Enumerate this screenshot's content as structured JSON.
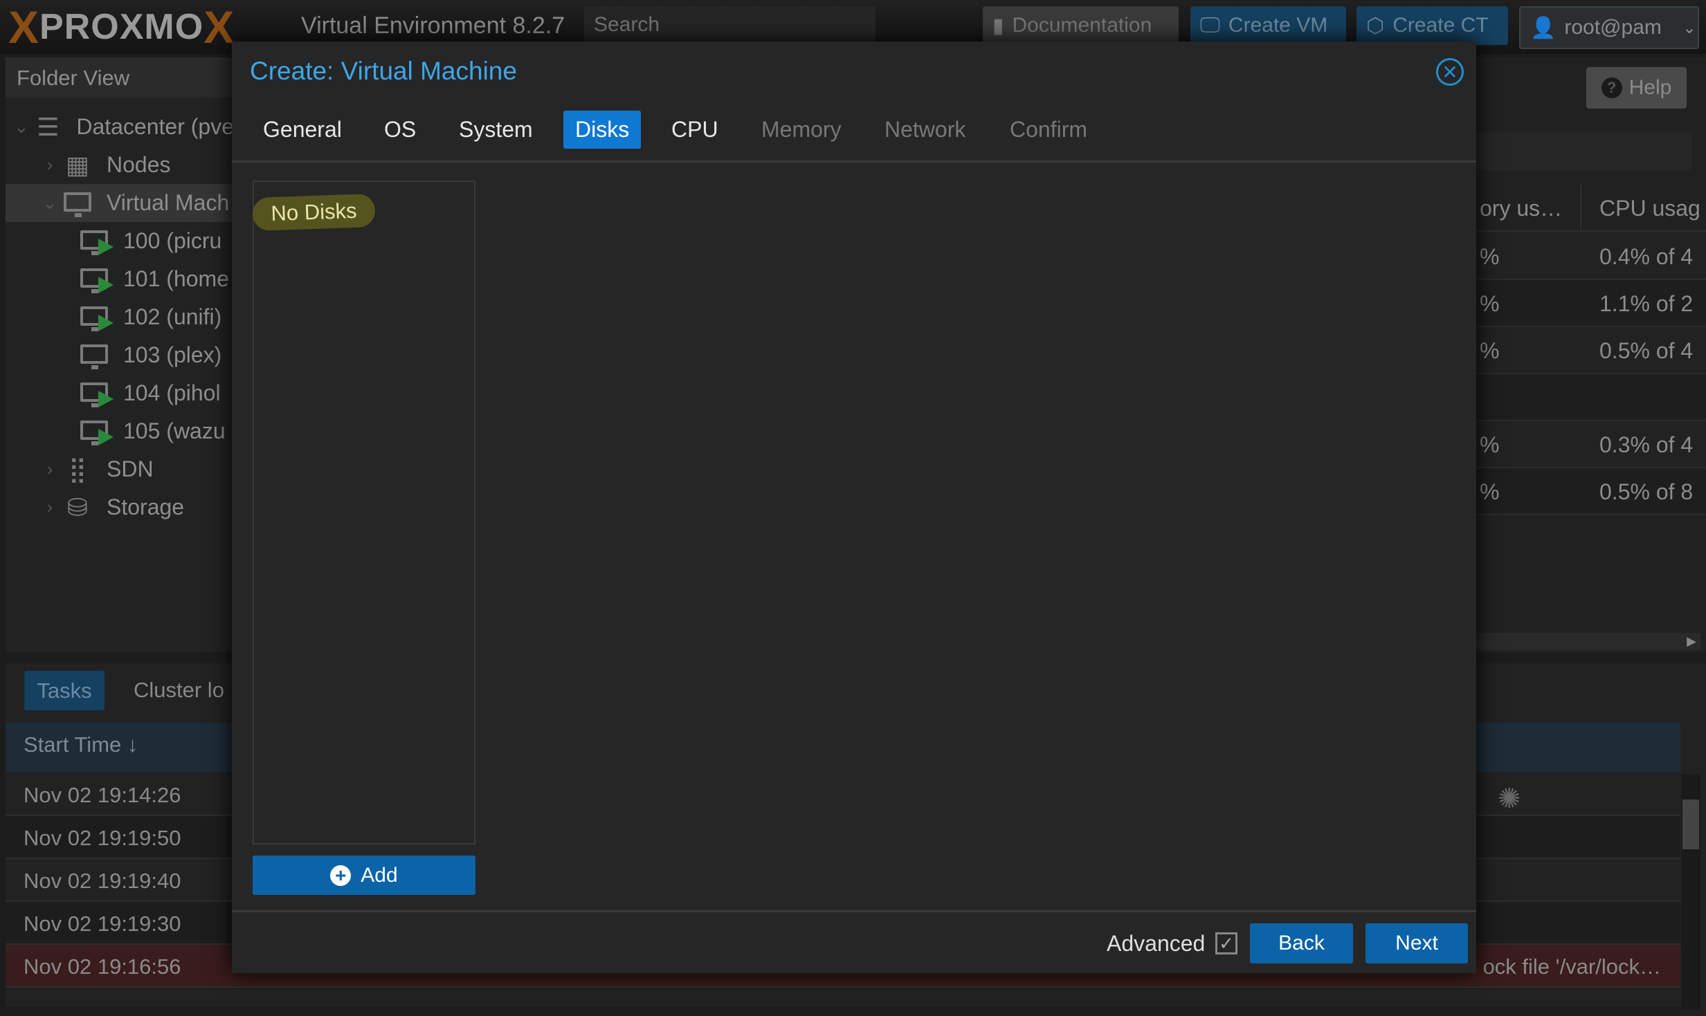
{
  "header": {
    "logo": "PROXMOX",
    "version": "Virtual Environment 8.2.7",
    "search_placeholder": "Search",
    "documentation": "Documentation",
    "create_vm": "Create VM",
    "create_ct": "Create CT",
    "user": "root@pam"
  },
  "sidebar": {
    "view": "Folder View",
    "items": [
      {
        "label": "Datacenter (pve",
        "icon": "server-icon"
      },
      {
        "label": "Nodes",
        "icon": "building-icon"
      },
      {
        "label": "Virtual Mach",
        "icon": "desktop-icon"
      },
      {
        "label": "100 (picru",
        "icon": "vm-running-icon"
      },
      {
        "label": "101 (home",
        "icon": "vm-running-icon"
      },
      {
        "label": "102 (unifi)",
        "icon": "vm-running-icon"
      },
      {
        "label": "103 (plex)",
        "icon": "vm-stopped-icon"
      },
      {
        "label": "104 (pihol",
        "icon": "vm-running-icon"
      },
      {
        "label": "105 (wazu",
        "icon": "vm-running-icon"
      },
      {
        "label": "SDN",
        "icon": "grid-icon"
      },
      {
        "label": "Storage",
        "icon": "database-icon"
      }
    ]
  },
  "content": {
    "help": "Help",
    "columns": [
      "ory us…",
      "CPU usag"
    ],
    "rows": [
      [
        "%",
        "0.4% of 4"
      ],
      [
        "%",
        "1.1% of 2"
      ],
      [
        "%",
        "0.5% of 4"
      ],
      [
        "",
        ""
      ],
      [
        "%",
        "0.3% of 4"
      ],
      [
        "%",
        "0.5% of 8"
      ]
    ]
  },
  "tasks": {
    "tabs": [
      "Tasks",
      "Cluster lo"
    ],
    "header": "Start Time",
    "rows": [
      {
        "start": "Nov 02 19:14:26",
        "status": ""
      },
      {
        "start": "Nov 02 19:19:50",
        "status": ""
      },
      {
        "start": "Nov 02 19:19:40",
        "status": ""
      },
      {
        "start": "Nov 02 19:19:30",
        "status": ""
      },
      {
        "start": "Nov 02 19:16:56",
        "status": "ock file '/var/lock…"
      }
    ]
  },
  "modal": {
    "title": "Create: Virtual Machine",
    "tabs": [
      "General",
      "OS",
      "System",
      "Disks",
      "CPU",
      "Memory",
      "Network",
      "Confirm"
    ],
    "active_tab": "Disks",
    "empty": "No Disks",
    "add": "Add",
    "advanced": "Advanced",
    "advanced_checked": true,
    "back": "Back",
    "next": "Next"
  },
  "colors": {
    "accent": "#0f78d1",
    "title": "#3ea6e8",
    "error_row": "#3a1c1c",
    "running": "#2a8a3a"
  }
}
